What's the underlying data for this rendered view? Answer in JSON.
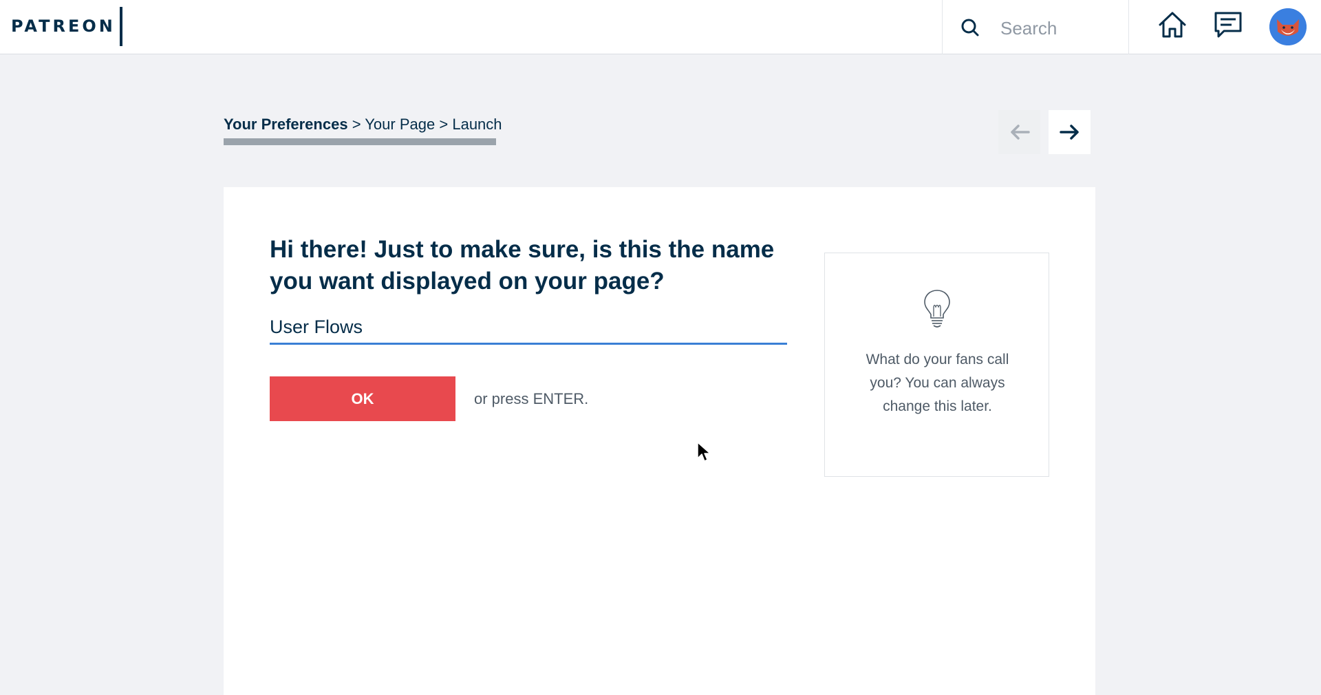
{
  "header": {
    "logo_text": "PATREON",
    "search_placeholder": "Search",
    "icons": [
      "search-icon",
      "home-icon",
      "messages-icon",
      "avatar"
    ]
  },
  "breadcrumb": {
    "steps": [
      "Your Preferences",
      "Your Page",
      "Launch"
    ],
    "separator": ">",
    "active_index": 0
  },
  "navigation": {
    "prev_icon": "arrow-left-icon",
    "next_icon": "arrow-right-icon"
  },
  "form": {
    "question": "Hi there! Just to make sure, is this the name you want displayed on your page?",
    "name_value": "User Flows",
    "ok_label": "OK",
    "enter_hint": "or press ENTER."
  },
  "tip": {
    "icon": "lightbulb-icon",
    "text": "What do your fans call you? You can always change this later."
  },
  "colors": {
    "brand_navy": "#052d49",
    "ok_button": "#e8494e",
    "input_underline": "#3a7fd5",
    "page_background": "#f1f2f5"
  }
}
